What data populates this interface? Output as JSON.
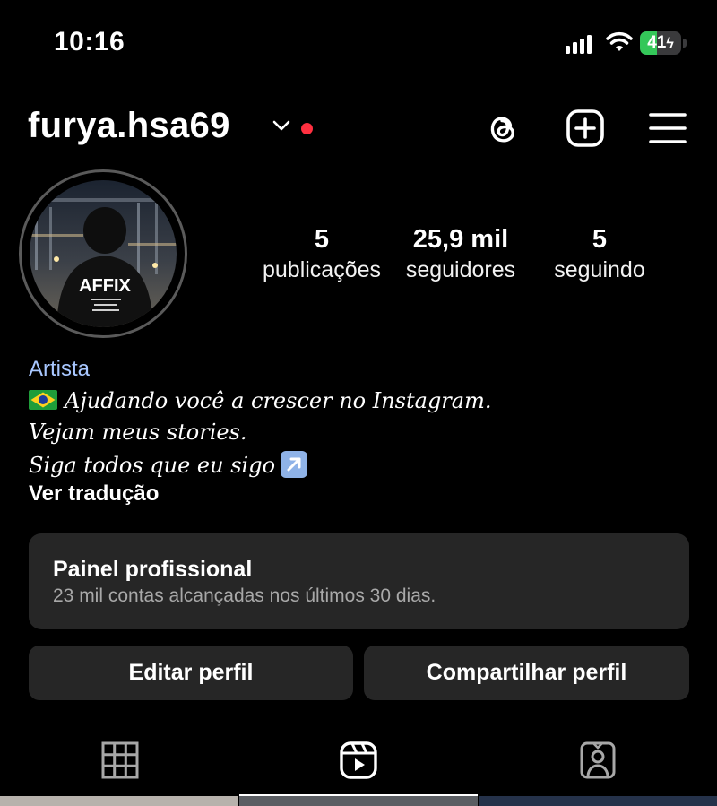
{
  "status_bar": {
    "time": "10:16",
    "battery_level": "41",
    "battery_fraction": 0.41,
    "battery_charging": true,
    "icons": [
      "cellular-signal-icon",
      "wifi-icon",
      "battery-icon"
    ]
  },
  "header": {
    "username": "furya.hsa69",
    "icons": [
      "chevron-down-icon",
      "notification-dot",
      "threads-icon",
      "new-post-icon",
      "menu-icon"
    ]
  },
  "stats": [
    {
      "value": "5",
      "label": "publicações"
    },
    {
      "value": "25,9 mil",
      "label": "seguidores"
    },
    {
      "value": "5",
      "label": "seguindo"
    }
  ],
  "bio": {
    "category": "Artista",
    "line1": "Ajudando você a crescer no Instagram.",
    "line2": "Vejam meus stories.",
    "line3": "Siga todos que eu sigo",
    "translate": "Ver tradução"
  },
  "panel": {
    "title": "Painel profissional",
    "subtitle": "23 mil contas alcançadas nos últimos 30 dias."
  },
  "buttons": {
    "edit": "Editar perfil",
    "share": "Compartilhar perfil"
  },
  "tabs": [
    "grid-icon",
    "reels-icon",
    "tagged-icon"
  ],
  "avatar": {
    "jacket_text": "AFFIX"
  },
  "colors": {
    "accent_link": "#a8c7ff",
    "notification_red": "#ff3040",
    "battery_green": "#34c759",
    "card_bg": "#262626"
  }
}
